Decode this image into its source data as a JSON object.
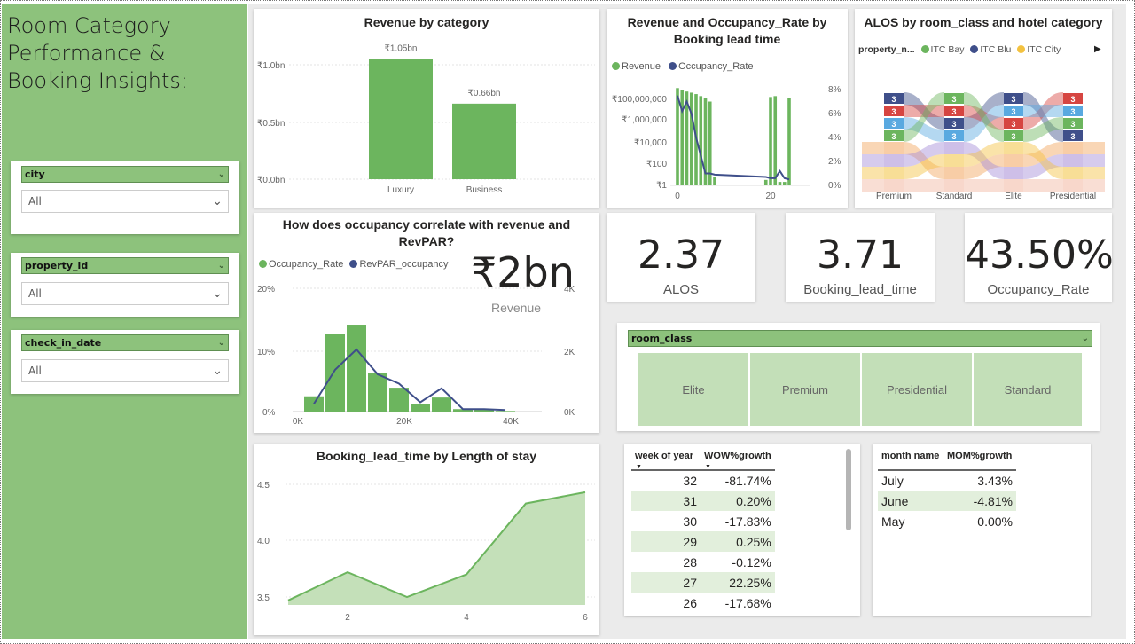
{
  "title": "Room Category Performance & Booking Insights:",
  "slicers": [
    {
      "label": "city",
      "value": "All"
    },
    {
      "label": "property_id",
      "value": "All"
    },
    {
      "label": "check_in_date",
      "value": "All"
    }
  ],
  "revenue_by_category": {
    "title": "Revenue by category",
    "y_ticks": [
      "₹1.0bn",
      "₹0.5bn",
      "₹0.0bn"
    ],
    "chart_data": {
      "type": "bar",
      "categories": [
        "Luxury",
        "Business"
      ],
      "values": [
        1.05,
        0.66
      ],
      "data_labels": [
        "₹1.05bn",
        "₹0.66bn"
      ],
      "ylim": [
        0,
        1.2
      ]
    }
  },
  "lead_time_chart": {
    "title": "Revenue and Occupancy_Rate by Booking lead time",
    "legend": [
      "Revenue",
      "Occupancy_Rate"
    ],
    "y_left_ticks": [
      "₹100,000,000",
      "₹1,000,000",
      "₹10,000",
      "₹100",
      "₹1"
    ],
    "y_right_ticks": [
      "8%",
      "6%",
      "4%",
      "2%",
      "0%"
    ],
    "x_ticks": [
      "0",
      "20"
    ],
    "chart_data": {
      "type": "bar",
      "x": [
        0,
        1,
        2,
        3,
        4,
        5,
        6,
        7,
        8,
        19,
        20,
        21,
        22,
        23,
        24
      ],
      "revenue": [
        300000000,
        200000000,
        150000000,
        120000000,
        90000000,
        60000000,
        40000000,
        20000000,
        5,
        3,
        50000000,
        60000000,
        2,
        2,
        40000000
      ],
      "occupancy_rate": [
        7.5,
        6.2,
        7.0,
        6.0,
        4.0,
        2.5,
        1.0,
        1.0,
        0.9,
        0.7,
        0.6,
        0.6,
        1.2,
        0.6,
        0.5
      ]
    }
  },
  "alos_chart": {
    "title": "ALOS by room_class and hotel category",
    "legend_title": "property_n...",
    "legend": [
      "ITC Bay",
      "ITC Blu",
      "ITC City"
    ],
    "legend_more": "▶",
    "categories": [
      "Premium",
      "Standard",
      "Elite",
      "Presidential"
    ],
    "band_label": "3"
  },
  "occupancy_chart": {
    "title": "How does occupancy correlate with revenue and RevPAR?",
    "legend": [
      "Occupancy_Rate",
      "RevPAR_occupancy"
    ],
    "y_left_ticks": [
      "20%",
      "10%",
      "0%"
    ],
    "y_right_ticks": [
      "4K",
      "2K",
      "0K"
    ],
    "x_ticks": [
      "0K",
      "20K",
      "40K"
    ],
    "big_value": "₹2bn",
    "big_label": "Revenue",
    "chart_data": {
      "type": "bar",
      "x_k": [
        3,
        7,
        11,
        15,
        19,
        23,
        27,
        31,
        35,
        39
      ],
      "occupancy_pct": [
        2.5,
        12.7,
        14.2,
        6.3,
        3.9,
        1.2,
        2.3,
        0.4,
        0.3,
        0.1
      ],
      "revpar": [
        250,
        1350,
        2000,
        1200,
        900,
        300,
        750,
        80,
        80,
        50
      ]
    }
  },
  "kpis": [
    {
      "value": "2.37",
      "label": "ALOS"
    },
    {
      "value": "3.71",
      "label": "Booking_lead_time"
    },
    {
      "value": "43.50%",
      "label": "Occupancy_Rate"
    }
  ],
  "room_class_slicer": {
    "label": "room_class",
    "options": [
      "Elite",
      "Premium",
      "Presidential",
      "Standard"
    ]
  },
  "los_chart": {
    "title": "Booking_lead_time by Length of stay",
    "y_ticks": [
      "4.5",
      "4.0",
      "3.5"
    ],
    "x_ticks": [
      "2",
      "4",
      "6"
    ],
    "chart_data": {
      "type": "area",
      "x": [
        1,
        2,
        3,
        4,
        5,
        6
      ],
      "y": [
        3.47,
        3.72,
        3.5,
        3.7,
        4.33,
        4.43
      ]
    }
  },
  "wow_table": {
    "headers": [
      "week of year",
      "WOW%growth"
    ],
    "rows": [
      [
        "32",
        "-81.74%"
      ],
      [
        "31",
        "0.20%"
      ],
      [
        "30",
        "-17.83%"
      ],
      [
        "29",
        "0.25%"
      ],
      [
        "28",
        "-0.12%"
      ],
      [
        "27",
        "22.25%"
      ],
      [
        "26",
        "-17.68%"
      ]
    ]
  },
  "mom_table": {
    "headers": [
      "month name",
      "MOM%growth"
    ],
    "rows": [
      [
        "July",
        "3.43%"
      ],
      [
        "June",
        "-4.81%"
      ],
      [
        "May",
        "0.00%"
      ]
    ]
  },
  "colors": {
    "green": "#6cb55e",
    "navy": "#3f4f8a",
    "sidebar": "#8dc27c",
    "tile": "#c3dfb8",
    "yellow": "#f3c240",
    "red": "#d64541",
    "blue": "#59a9e0"
  }
}
